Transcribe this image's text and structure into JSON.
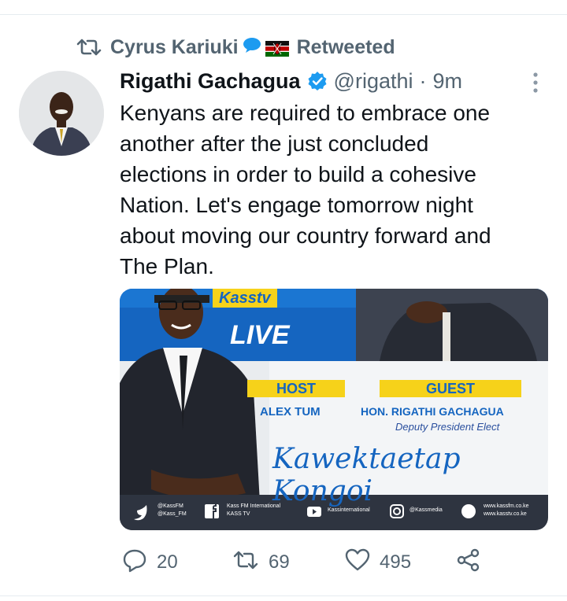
{
  "retweet": {
    "by_name": "Cyrus Kariuki",
    "label": "Retweeted"
  },
  "tweet": {
    "author_name": "Rigathi Gachagua",
    "handle": "@rigathi",
    "separator": "·",
    "time": "9m",
    "text": "Kenyans are required to embrace one\nanother after the just concluded\nelections in order to build a cohesive\nNation. Let's engage tomorrow night\nabout moving our country forward and\nThe Plan."
  },
  "media": {
    "brand": "Kasstv",
    "live_label": "LIVE",
    "host_label": "HOST",
    "host_name": "ALEX TUM",
    "guest_label": "GUEST",
    "guest_name": "HON. RIGATHI GACHAGUA",
    "guest_title": "Deputy President Elect",
    "show_name": "Kawektaetap Kongoi",
    "footer": {
      "twitter_1": "@KassFM",
      "twitter_2": "@Kass_FM",
      "facebook_1": "Kass FM International",
      "facebook_2": "KASS TV",
      "youtube": "Kassinternational",
      "instagram": "@Kassmedia",
      "web_1": "www.kassfm.co.ke",
      "web_2": "www.kasstv.co.ke"
    }
  },
  "actions": {
    "replies": "20",
    "retweets": "69",
    "likes": "495"
  },
  "colors": {
    "accent": "#1d9bf0",
    "secondary_text": "#536471",
    "live_banner": "#1565c0",
    "label_yellow": "#f6d21a",
    "footer_bar": "#2e3440"
  },
  "icons": [
    "retweet-icon",
    "speech-bubble-icon",
    "kenya-flag-icon",
    "verified-badge-icon",
    "more-vertical-icon",
    "reply-icon",
    "heart-icon",
    "share-icon"
  ]
}
